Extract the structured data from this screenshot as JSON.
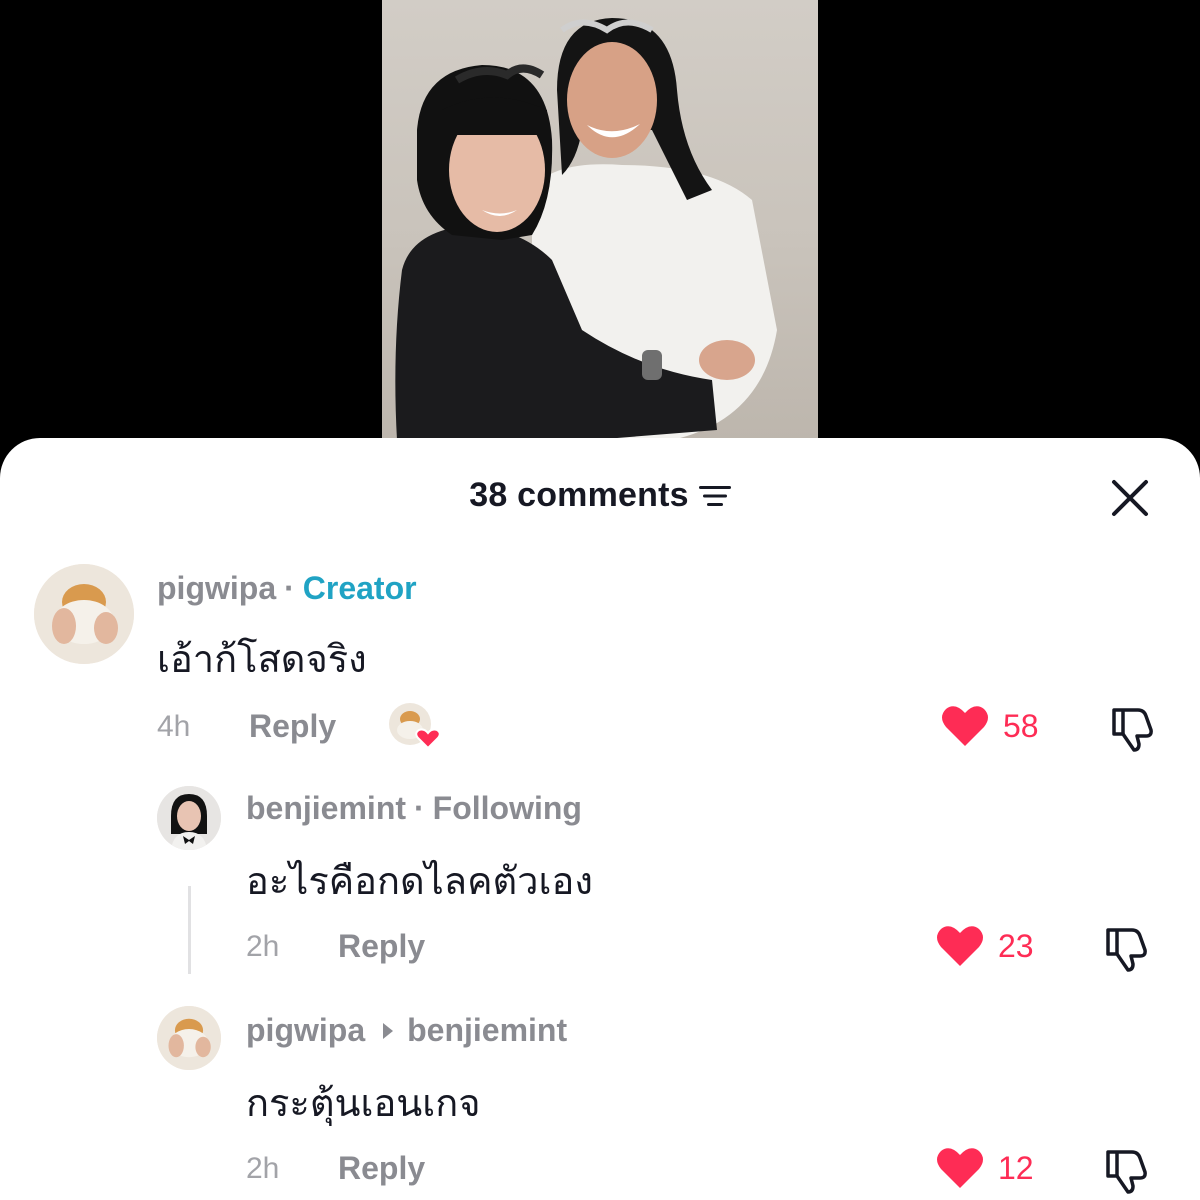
{
  "video": {
    "left_bg": "#000000",
    "frame_bg": "#cdc8c0"
  },
  "sheet": {
    "comment_count_label": "38 comments",
    "sort_icon": "sort-lines-icon",
    "close_icon": "close-x-icon"
  },
  "comments": [
    {
      "username": "pigwipa",
      "separator": "·",
      "badge": "Creator",
      "text": "เอ้าก้โสดจริง",
      "time": "4h",
      "reply_label": "Reply",
      "likes": "58",
      "liked_by_creator": true
    },
    {
      "username": "benjiemint",
      "separator": "·",
      "badge": "Following",
      "text": "อะไรคือกดไลคตัวเอง",
      "time": "2h",
      "reply_label": "Reply",
      "likes": "23"
    },
    {
      "username": "pigwipa",
      "reply_to": "benjiemint",
      "text": "กระตุ้นเอนเกจ",
      "time": "2h",
      "reply_label": "Reply",
      "likes": "12"
    }
  ],
  "colors": {
    "accent_like": "#fe2c55",
    "creator_badge": "#20a3c4",
    "primary_text": "#161823",
    "secondary_text": "#8a8b91"
  }
}
